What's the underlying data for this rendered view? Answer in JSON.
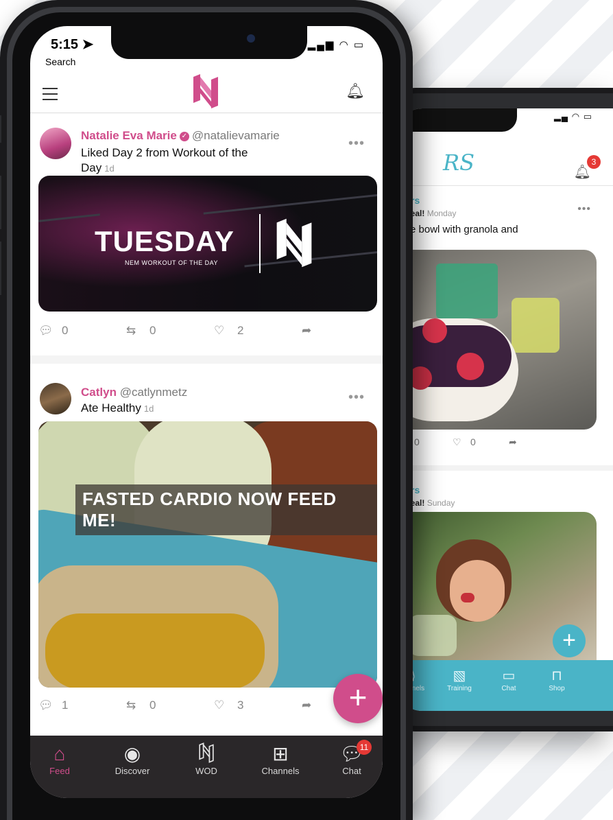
{
  "front": {
    "status": {
      "time": "5:15",
      "back_label": "Search"
    },
    "posts": [
      {
        "name": "Natalie Eva Marie",
        "handle": "@natalievamarie",
        "activity_line1": "Liked Day 2 from Workout of the",
        "activity_line2": "Day",
        "time": "1d",
        "image_title": "TUESDAY",
        "image_subtitle": "NEM WORKOUT OF THE DAY",
        "comments": "0",
        "reposts": "0",
        "likes": "2"
      },
      {
        "name": "Catlyn",
        "handle": "@catlynmetz",
        "activity": "Ate Healthy",
        "time": "1d",
        "image_caption": "FASTED CARDIO NOW FEED ME!",
        "comments": "1",
        "reposts": "0",
        "likes": "3"
      }
    ],
    "fab_label": "+",
    "tabs": [
      {
        "label": "Feed",
        "icon": "home-icon"
      },
      {
        "label": "Discover",
        "icon": "compass-icon"
      },
      {
        "label": "WOD",
        "icon": "wod-logo-icon"
      },
      {
        "label": "Channels",
        "icon": "grid-icon"
      },
      {
        "label": "Chat",
        "icon": "chat-icon",
        "badge": "11"
      }
    ],
    "colors": {
      "accent": "#d04d8b",
      "tabbar": "#2a2729"
    }
  },
  "back": {
    "logo": "RS",
    "notification_badge": "3",
    "posts": [
      {
        "name": "thers",
        "meal": "y meal!",
        "day": "Monday",
        "text": "hine bowl with granola and",
        "reposts": "0",
        "likes": "0"
      },
      {
        "name": "thers",
        "meal": "y meal!",
        "day": "Sunday"
      }
    ],
    "fab_label": "+",
    "tabs": [
      {
        "label": "Channels",
        "icon": "mic-icon"
      },
      {
        "label": "Training",
        "icon": "training-icon"
      },
      {
        "label": "Chat",
        "icon": "chat-icon"
      },
      {
        "label": "Shop",
        "icon": "bag-icon"
      }
    ],
    "colors": {
      "accent": "#4ab4c7"
    }
  }
}
